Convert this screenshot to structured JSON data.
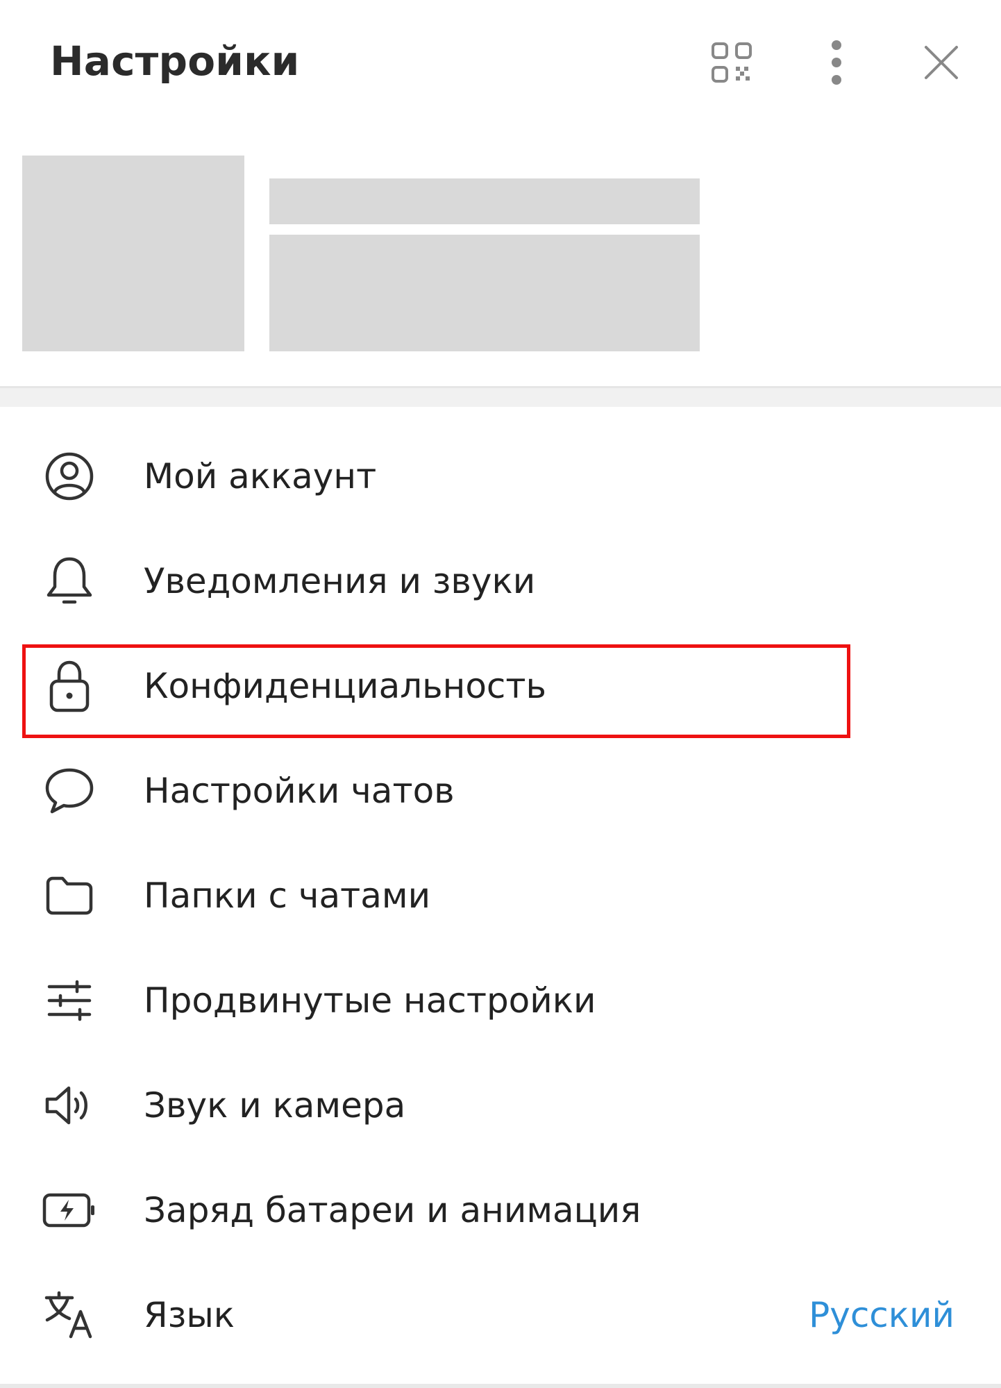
{
  "header": {
    "title": "Настройки",
    "qr_icon": "qr-code-icon",
    "more_icon": "more-vertical-icon",
    "close_icon": "close-icon"
  },
  "menu": {
    "items": [
      {
        "label": "Мой аккаунт",
        "icon": "account-circle-icon"
      },
      {
        "label": "Уведомления и звуки",
        "icon": "bell-icon"
      },
      {
        "label": "Конфиденциальность",
        "icon": "lock-icon"
      },
      {
        "label": "Настройки чатов",
        "icon": "chat-bubble-icon"
      },
      {
        "label": "Папки с чатами",
        "icon": "folder-icon"
      },
      {
        "label": "Продвинутые настройки",
        "icon": "sliders-icon"
      },
      {
        "label": "Звук и камера",
        "icon": "speaker-icon"
      },
      {
        "label": "Заряд батареи и анимация",
        "icon": "battery-charge-icon"
      },
      {
        "label": "Язык",
        "icon": "translate-icon",
        "value": "Русский"
      }
    ]
  },
  "colors": {
    "accent_value": "#2e8fd8",
    "highlight": "#ee1111",
    "placeholder": "#d9d9d9"
  }
}
